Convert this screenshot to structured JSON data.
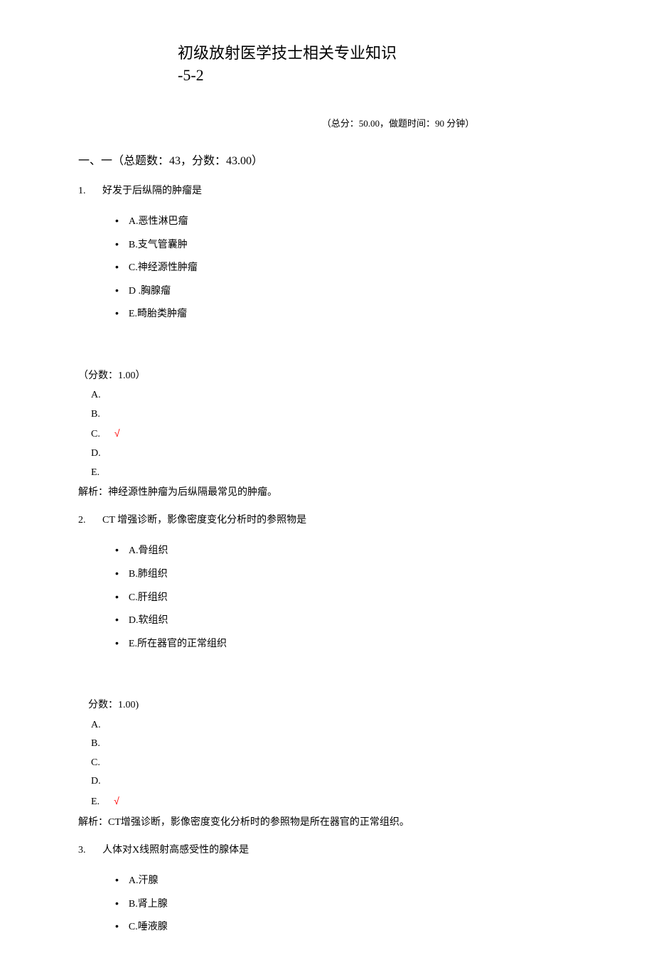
{
  "title_line1": "初级放射医学技士相关专业知识",
  "title_line2": "-5-2",
  "exam_info": "（总分：50.00，做题时间：90 分钟）",
  "section_header": "一、一（总题数：43，分数：43.00）",
  "questions": [
    {
      "number": "1.",
      "text": "好发于后纵隔的肿瘤是",
      "options": [
        "A.恶性淋巴瘤",
        "B.支气管囊肿",
        "C.神经源性肿瘤",
        "D .胸腺瘤",
        "E.畸胎类肿瘤"
      ],
      "score": "（分数：1.00）",
      "answers": [
        "A.",
        "B.",
        "C.",
        "D.",
        "E."
      ],
      "correct_index": 2,
      "check_mark": "√",
      "explanation": "解析：神经源性肿瘤为后纵隔最常见的肿瘤。"
    },
    {
      "number": "2.",
      "text": "CT 增强诊断，影像密度变化分析时的参照物是",
      "options": [
        "A.骨组织",
        "B.肺组织",
        "C.肝组织",
        "D.软组织",
        "E.所在器官的正常组织"
      ],
      "score": "分数：1.00)",
      "answers": [
        "A.",
        "B.",
        "C.",
        "D.",
        "E."
      ],
      "correct_index": 4,
      "check_mark": "√",
      "explanation": "解析：CT增强诊断，影像密度变化分析时的参照物是所在器官的正常组织。"
    },
    {
      "number": "3.",
      "text": "人体对X线照射高感受性的腺体是",
      "options": [
        "A.汗腺",
        "B.肾上腺",
        "C.唾液腺"
      ]
    }
  ]
}
